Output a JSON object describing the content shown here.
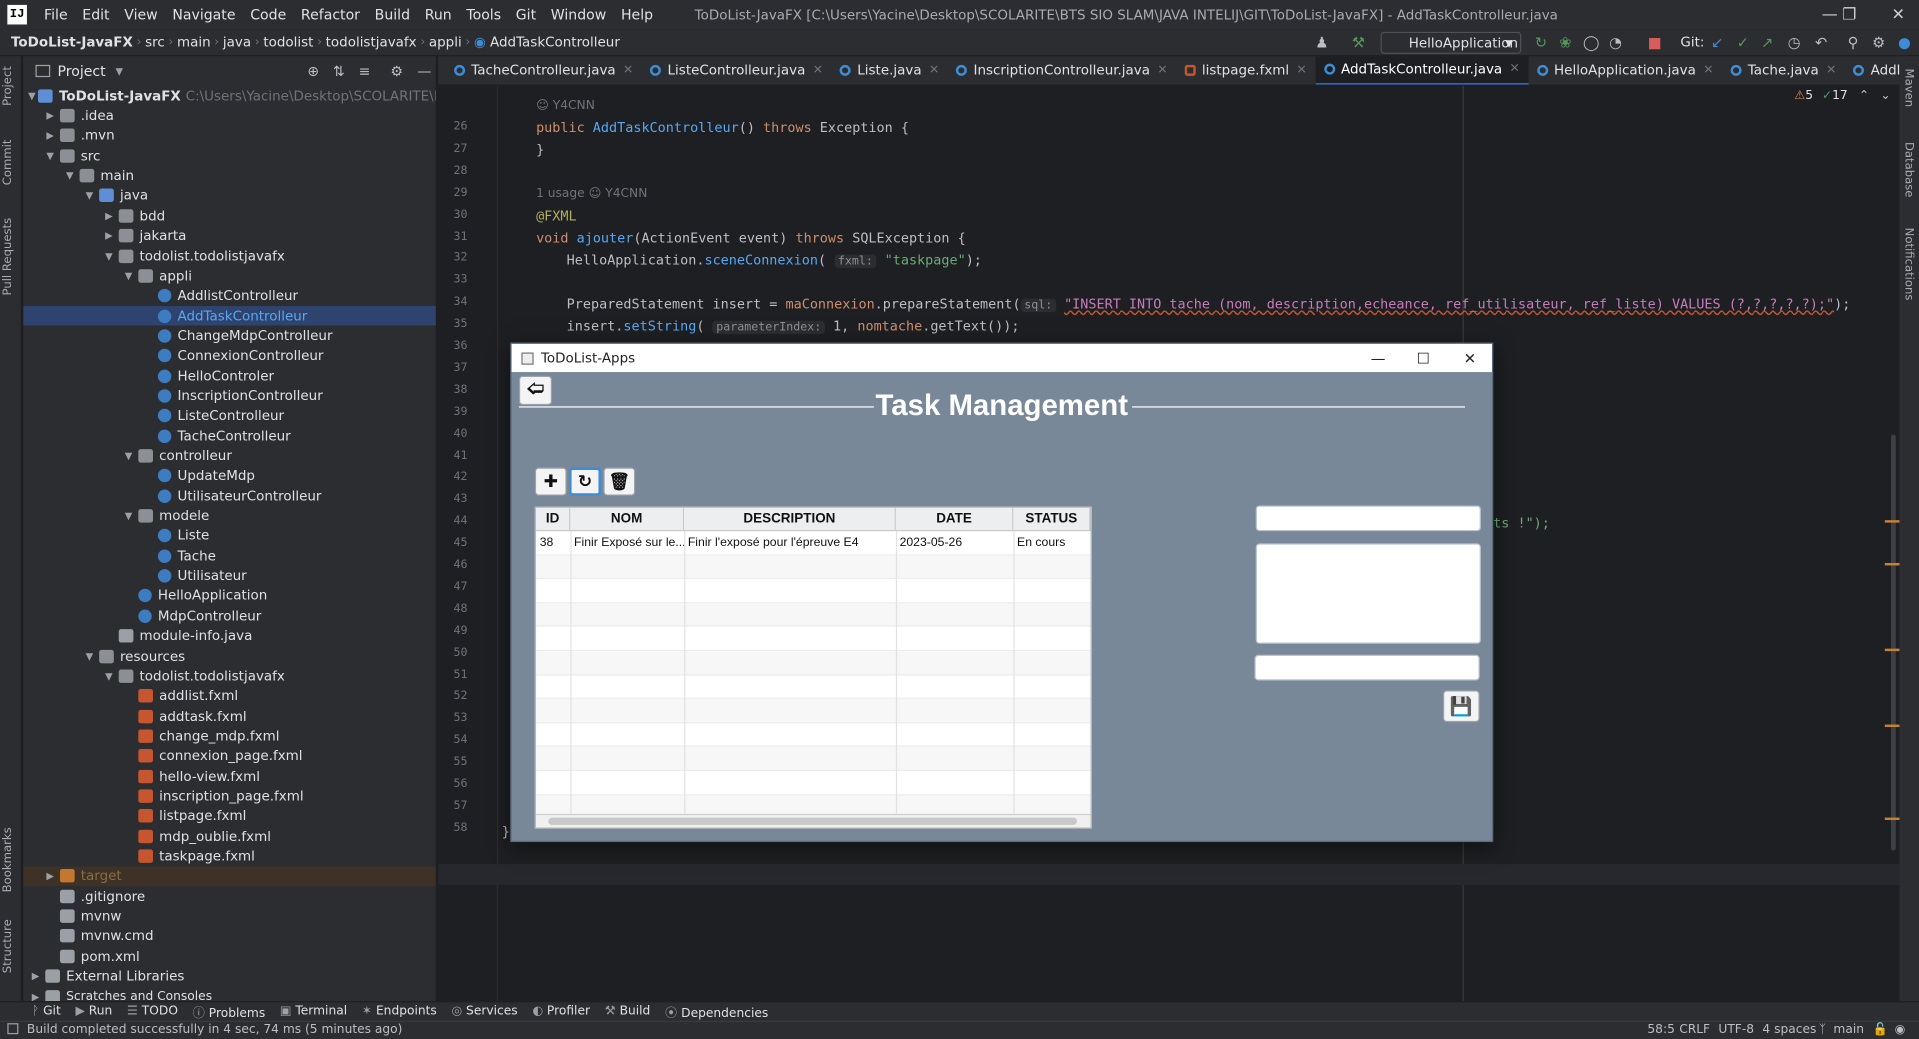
{
  "menu": {
    "items": [
      "File",
      "Edit",
      "View",
      "Navigate",
      "Code",
      "Refactor",
      "Build",
      "Run",
      "Tools",
      "Git",
      "Window",
      "Help"
    ],
    "window_title": "ToDoList-JavaFX [C:\\Users\\Yacine\\Desktop\\SCOLARITE\\BTS SIO SLAM\\JAVA INTELIJ\\GIT\\ToDoList-JavaFX] - AddTaskControlleur.java"
  },
  "breadcrumb": [
    "ToDoList-JavaFX",
    "src",
    "main",
    "java",
    "todolist",
    "todolistjavafx",
    "appli",
    "AddTaskControlleur"
  ],
  "toolbar": {
    "run_config": "HelloApplication",
    "git_label": "Git:"
  },
  "left_strip": {
    "project": "Project",
    "commit": "Commit",
    "pull_requests": "Pull Requests",
    "bookmarks": "Bookmarks",
    "structure": "Structure"
  },
  "right_strip": {
    "maven": "Maven",
    "database": "Database",
    "notifications": "Notifications"
  },
  "project_panel": {
    "title": "Project",
    "root": "ToDoList-JavaFX",
    "root_path": "C:\\Users\\Yacine\\Desktop\\SCOLARITE\\BTS SIO SLAM",
    "items": [
      ".idea",
      ".mvn",
      "src",
      "main",
      "java",
      "bdd",
      "jakarta",
      "todolist.todolistjavafx",
      "appli",
      "AddlistControlleur",
      "AddTaskControlleur",
      "ChangeMdpControlleur",
      "ConnexionControlleur",
      "HelloControler",
      "InscriptionControlleur",
      "ListeControlleur",
      "TacheControlleur",
      "controlleur",
      "UpdateMdp",
      "UtilisateurControlleur",
      "modele",
      "Liste",
      "Tache",
      "Utilisateur",
      "HelloApplication",
      "MdpControlleur",
      "module-info.java",
      "resources",
      "todolist.todolistjavafx",
      "addlist.fxml",
      "addtask.fxml",
      "change_mdp.fxml",
      "connexion_page.fxml",
      "hello-view.fxml",
      "inscription_page.fxml",
      "listpage.fxml",
      "mdp_oublie.fxml",
      "taskpage.fxml",
      "target",
      ".gitignore",
      "mvnw",
      "mvnw.cmd",
      "pom.xml",
      "External Libraries",
      "Scratches and Consoles"
    ]
  },
  "tabs": [
    "TacheControlleur.java",
    "ListeControlleur.java",
    "Liste.java",
    "InscriptionControlleur.java",
    "listpage.fxml",
    "AddTaskControlleur.java",
    "HelloApplication.java",
    "Tache.java",
    "AddlistControlleur.java"
  ],
  "inspections": {
    "warnings": "5",
    "ok": "17"
  },
  "code": {
    "author1": "Y4CNN",
    "usage": "1 usage",
    "author2": "Y4CNN",
    "l26": [
      "public",
      "AddTaskControlleur",
      "()",
      "throws",
      "Exception",
      "{"
    ],
    "l30": "void",
    "ajouter": "ajouter",
    "params": "(ActionEvent event)",
    "l30b": "SQLException",
    "l31a": "HelloApplication.",
    "l31b": "sceneConnexion",
    "l31hint": "fxml:",
    "l31str": "\"taskpage\"",
    "l33a": "PreparedStatement insert = ",
    "l33b": "maConnexion",
    "l33c": ".prepareStatement(",
    "l33hint": "sql:",
    "l33sql": "\"INSERT INTO tache (nom, description,echeance, ref_utilisateur, ref_liste) VALUES (?,?,?,?,?);\"",
    "l34a": "insert.",
    "l34b": "setString",
    "l34hint": "parameterIndex:",
    "l34c": "1, ",
    "l34d": "nomtache",
    "l34e": ".getText());",
    "l43": "ts !\");",
    "fxml_ann": "@FXML",
    "brace": "}",
    "lines": [
      "26",
      "27",
      "28",
      "29",
      "30",
      "31",
      "32",
      "33",
      "34",
      "35",
      "36",
      "37",
      "38",
      "39",
      "40",
      "41",
      "42",
      "43",
      "44",
      "45",
      "46",
      "47",
      "48",
      "49",
      "50",
      "51",
      "52",
      "53",
      "54",
      "55",
      "56",
      "57",
      "58"
    ]
  },
  "app": {
    "title": "ToDoList-Apps",
    "heading": "Task Management",
    "table": {
      "headers": [
        "ID",
        "NOM",
        "DESCRIPTION",
        "DATE",
        "STATUS"
      ],
      "rows": [
        [
          "38",
          "Finir Exposé sur le...",
          "Finir l'exposé pour l'épreuve E4",
          "2023-05-26",
          "En cours"
        ]
      ]
    }
  },
  "bottom_tools": [
    "Git",
    "Run",
    "TODO",
    "Problems",
    "Terminal",
    "Endpoints",
    "Services",
    "Profiler",
    "Build",
    "Dependencies"
  ],
  "status": {
    "message": "Build completed successfully in 4 sec, 74 ms (5 minutes ago)",
    "position": "58:5",
    "line_sep": "CRLF",
    "encoding": "UTF-8",
    "indent": "4 spaces",
    "branch": "main"
  }
}
